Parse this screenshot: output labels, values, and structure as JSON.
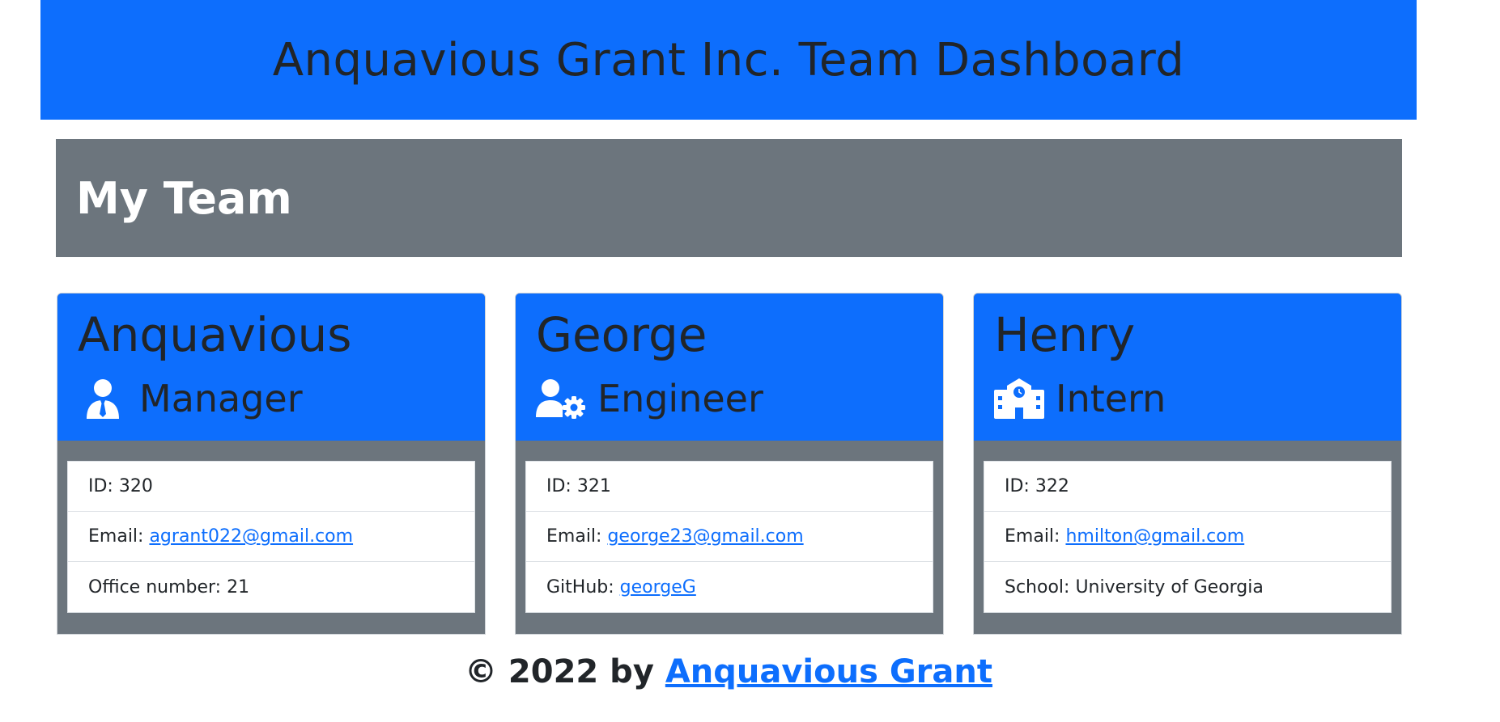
{
  "header": {
    "title": "Anquavious Grant Inc. Team Dashboard"
  },
  "team": {
    "title": "My Team"
  },
  "members": [
    {
      "name": "Anquavious",
      "role": "Manager",
      "icon": "user-tie-icon",
      "id_text": "ID: 320",
      "email_label": "Email: ",
      "email": "agrant022@gmail.com",
      "extra_label": "Office number: 21",
      "extra_link": ""
    },
    {
      "name": "George",
      "role": "Engineer",
      "icon": "user-gear-icon",
      "id_text": "ID: 321",
      "email_label": "Email: ",
      "email": "george23@gmail.com",
      "extra_label": "GitHub: ",
      "extra_link": "georgeG"
    },
    {
      "name": "Henry",
      "role": "Intern",
      "icon": "school-icon",
      "id_text": "ID: 322",
      "email_label": "Email: ",
      "email": "hmilton@gmail.com",
      "extra_label": "School: University of Georgia",
      "extra_link": ""
    }
  ],
  "footer": {
    "prefix": "© 2022 by ",
    "link": "Anquavious Grant"
  },
  "colors": {
    "primary": "#0d6efd",
    "secondary": "#6c757d",
    "text": "#212529"
  }
}
